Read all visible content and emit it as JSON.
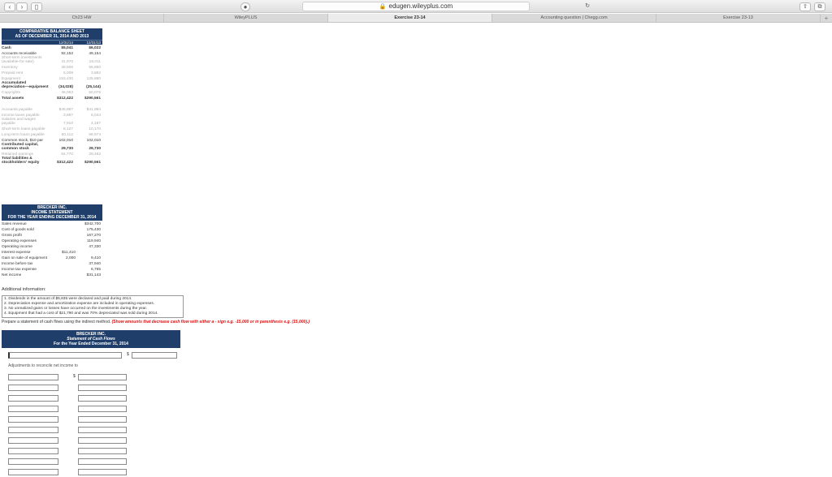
{
  "browser": {
    "address": "edugen.wileyplus.com",
    "tabs": [
      {
        "label": "Ch23 HW",
        "active": false
      },
      {
        "label": "WileyPLUS",
        "active": false
      },
      {
        "label": "Exercise 23-14",
        "active": true
      },
      {
        "label": "Accounting question | Chegg.com",
        "active": false
      },
      {
        "label": "Exercise 23-13",
        "active": false
      }
    ],
    "new_tab": "+"
  },
  "balance_sheet": {
    "title1": "COMPARATIVE BALANCE SHEET",
    "title2": "AS OF DECEMBER 31, 2014 AND 2013",
    "col1": "12/31/14",
    "col2": "12/31/13",
    "rows": [
      {
        "label": "Cash",
        "v1": "$5,041",
        "v2": "$6,022",
        "style": "b"
      },
      {
        "label": "Accounts receivable",
        "v1": "92,152",
        "v2": "49,154",
        "style": ""
      },
      {
        "label": "Short-term investments (available-for-sale)",
        "v1": "31,970",
        "v2": "18,011",
        "style": "g"
      },
      {
        "label": "Inventory",
        "v1": "39,506",
        "v2": "56,850",
        "style": "g"
      },
      {
        "label": "Prepaid rent",
        "v1": "5,009",
        "v2": "3,882",
        "style": "g"
      },
      {
        "label": "Equipment",
        "v1": "153,430",
        "v2": "125,880",
        "style": "g"
      },
      {
        "label": "Accumulated depreciation—equipment",
        "v1": "(34,028)",
        "v2": "(25,144)",
        "style": "b"
      },
      {
        "label": "Copyrights",
        "v1": "46,053",
        "v2": "50,076",
        "style": "g"
      },
      {
        "label": "Total assets",
        "v1": "$312,422",
        "v2": "$290,561",
        "style": "b"
      },
      {
        "label": "",
        "v1": "",
        "v2": "",
        "style": "gap"
      },
      {
        "label": "Accounts payable",
        "v1": "$45,887",
        "v2": "$41,984",
        "style": "g"
      },
      {
        "label": "Income taxes payable",
        "v1": "3,867",
        "v2": "6,044",
        "style": "g"
      },
      {
        "label": "Salaries and wages payable",
        "v1": "7,910",
        "v2": "4,187",
        "style": "g"
      },
      {
        "label": "Short-term loans payable",
        "v1": "8,127",
        "v2": "10,170",
        "style": "g"
      },
      {
        "label": "Long-term loans payable",
        "v1": "60,112",
        "v2": "66,974",
        "style": "g"
      },
      {
        "label": "Common stock, $10 par",
        "v1": "102,010",
        "v2": "102,010",
        "style": ""
      },
      {
        "label": "Contributed capital, common stock",
        "v1": "29,730",
        "v2": "29,730",
        "style": "b"
      },
      {
        "label": "Retained earnings",
        "v1": "54,770",
        "v2": "29,462",
        "style": "g"
      },
      {
        "label": "Total liabilities & stockholders' equity",
        "v1": "$312,422",
        "v2": "$290,561",
        "style": "b"
      }
    ]
  },
  "income_statement": {
    "title1": "BRECKER INC.",
    "title2": "INCOME STATEMENT",
    "title3": "FOR THE YEAR ENDING DECEMBER 31, 2014",
    "rows": [
      {
        "label": "Sales revenue",
        "a": "",
        "b": "$342,700"
      },
      {
        "label": "Cost of goods sold",
        "a": "",
        "b": "175,430"
      },
      {
        "label": "Gross profit",
        "a": "",
        "b": "167,270"
      },
      {
        "label": "Operating expenses",
        "a": "",
        "b": "119,940"
      },
      {
        "label": "Operating income",
        "a": "",
        "b": "47,330"
      },
      {
        "label": "Interest expense",
        "a": "$11,410",
        "b": ""
      },
      {
        "label": "Gain on sale of equipment",
        "a": "2,000",
        "b": "9,410"
      },
      {
        "label": "Income before tax",
        "a": "",
        "b": "37,940"
      },
      {
        "label": "Income tax expense",
        "a": "",
        "b": "6,765"
      },
      {
        "label": "Net income",
        "a": "",
        "b": "$31,143"
      }
    ]
  },
  "additional": {
    "heading": "Additional information:",
    "notes": [
      "1. Dividends in the amount of $5,835 were declared and paid during 2014.",
      "2. Depreciation expense and amortization expense are included in operating expenses.",
      "3. No unrealized gains or losses have occurred on the investments during the year.",
      "4. Equipment that had a cost of $21,790 and was 70% depreciated was sold during 2014."
    ]
  },
  "prompt": {
    "text": "Prepare a statement of cash flows using the indirect method.",
    "red": "(Show amounts that decrease cash flow with either a - sign e.g. -15,000 or in parenthesis e.g. (15,000).)"
  },
  "cash_flow": {
    "title1": "BRECKER INC.",
    "title2": "Statement of Cash Flows",
    "title3": "For the Year Ended December 31, 2014",
    "adjust_label": "Adjustments to reconcile net income to",
    "dollar": "$"
  }
}
